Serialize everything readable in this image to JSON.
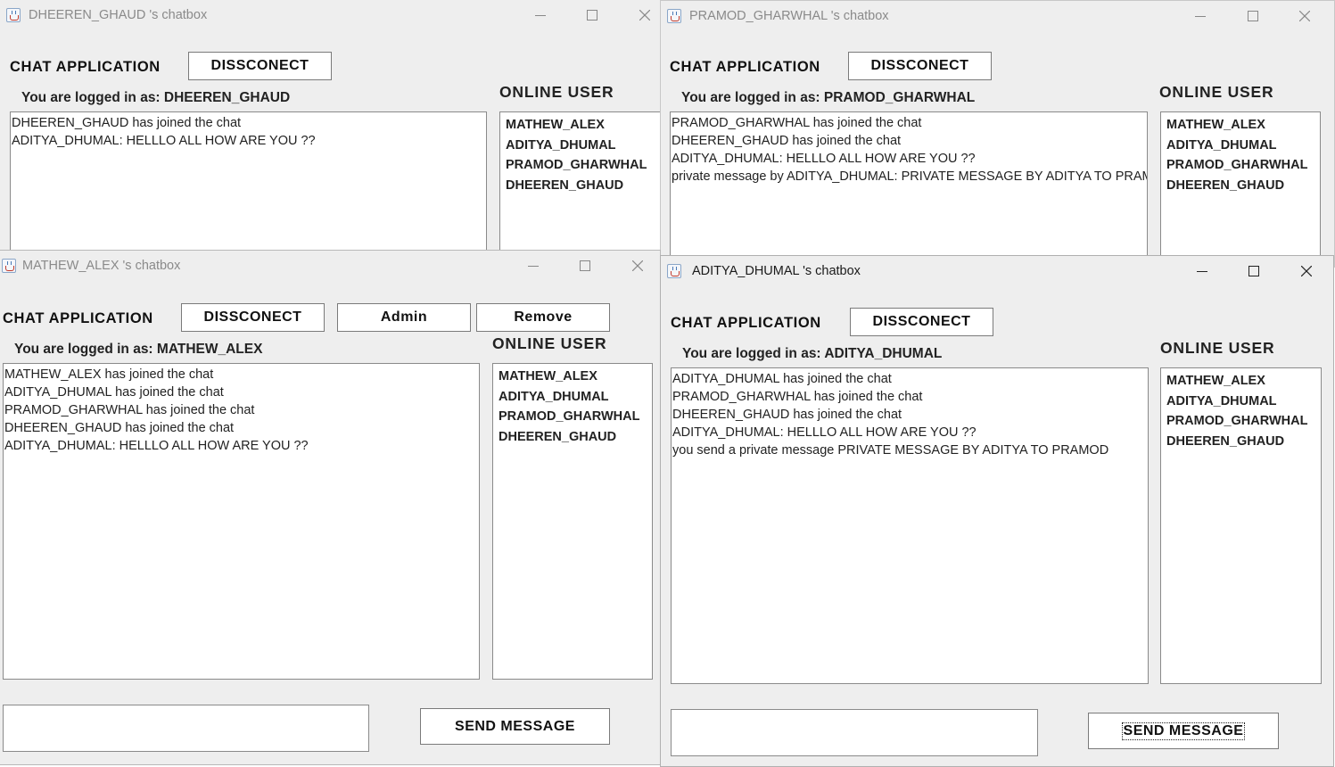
{
  "windows": {
    "dheeren": {
      "title": "DHEEREN_GHAUD 's chatbox",
      "app_label": "CHAT APPLICATION",
      "disconnect_label": "DISSCONECT",
      "logged_in": "You are logged in as: DHEEREN_GHAUD",
      "online_title": "ONLINE USER",
      "messages": [
        "DHEEREN_GHAUD has joined the chat",
        "ADITYA_DHUMAL: HELLLO ALL HOW ARE YOU ??"
      ],
      "users": [
        "MATHEW_ALEX",
        "ADITYA_DHUMAL",
        "PRAMOD_GHARWHAL",
        "DHEEREN_GHAUD"
      ]
    },
    "pramod": {
      "title": "PRAMOD_GHARWHAL 's chatbox",
      "app_label": "CHAT APPLICATION",
      "disconnect_label": "DISSCONECT",
      "logged_in": "You are logged in as: PRAMOD_GHARWHAL",
      "online_title": "ONLINE USER",
      "messages": [
        "PRAMOD_GHARWHAL has joined the chat",
        "DHEEREN_GHAUD has joined the chat",
        "ADITYA_DHUMAL: HELLLO ALL HOW ARE YOU ??",
        "private message by ADITYA_DHUMAL: PRIVATE MESSAGE BY ADITYA TO PRAMOD"
      ],
      "users": [
        "MATHEW_ALEX",
        "ADITYA_DHUMAL",
        "PRAMOD_GHARWHAL",
        "DHEEREN_GHAUD"
      ]
    },
    "mathew": {
      "title": "MATHEW_ALEX 's chatbox",
      "app_label": "CHAT APPLICATION",
      "disconnect_label": "DISSCONECT",
      "admin_label": "Admin",
      "remove_label": "Remove",
      "logged_in": "You are logged in as: MATHEW_ALEX",
      "online_title": "ONLINE USER",
      "messages": [
        "MATHEW_ALEX has joined the chat",
        "ADITYA_DHUMAL has joined the chat",
        "PRAMOD_GHARWHAL has joined the chat",
        "DHEEREN_GHAUD has joined the chat",
        "ADITYA_DHUMAL: HELLLO ALL HOW ARE YOU ??"
      ],
      "users": [
        "MATHEW_ALEX",
        "ADITYA_DHUMAL",
        "PRAMOD_GHARWHAL",
        "DHEEREN_GHAUD"
      ],
      "message_input_value": "",
      "send_label": "SEND MESSAGE"
    },
    "aditya": {
      "title": "ADITYA_DHUMAL 's chatbox",
      "app_label": "CHAT APPLICATION",
      "disconnect_label": "DISSCONECT",
      "logged_in": "You are logged in as: ADITYA_DHUMAL",
      "online_title": "ONLINE USER",
      "messages": [
        "ADITYA_DHUMAL has joined the chat",
        "PRAMOD_GHARWHAL has joined the chat",
        "DHEEREN_GHAUD has joined the chat",
        "ADITYA_DHUMAL: HELLLO ALL HOW ARE YOU ??",
        "you send a private message  PRIVATE MESSAGE BY ADITYA TO PRAMOD"
      ],
      "users": [
        "MATHEW_ALEX",
        "ADITYA_DHUMAL",
        "PRAMOD_GHARWHAL",
        "DHEEREN_GHAUD"
      ],
      "message_input_value": "",
      "send_label": "SEND MESSAGE"
    }
  },
  "icons": {
    "minimize": "minimize-icon",
    "maximize": "maximize-icon",
    "close": "close-icon",
    "app": "java-app-icon"
  }
}
